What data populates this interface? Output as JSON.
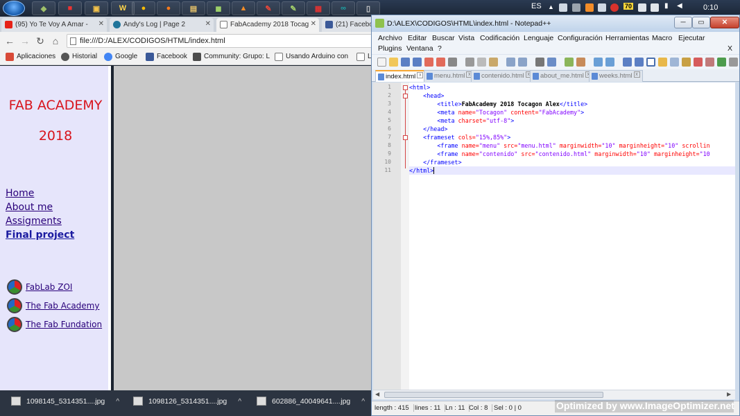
{
  "taskbar": {
    "apps": [
      "",
      "",
      "",
      "",
      "",
      "",
      "",
      "",
      "",
      "",
      "",
      "",
      "",
      ""
    ],
    "language": "ES",
    "badge": "70",
    "clock": "0:10"
  },
  "browser": {
    "tabs": [
      {
        "label": "(95) Yo Te Voy A Amar -",
        "color": "#e62117"
      },
      {
        "label": "Andy's Log | Page 2",
        "color": "#21759b"
      },
      {
        "label": "FabAcademy 2018 Tocag",
        "color": "#777777"
      },
      {
        "label": "(21) Facebo",
        "color": "#3b5998"
      }
    ],
    "url": "file:///D:/ALEX/CODIGOS/HTML/index.html",
    "bookmarks": [
      {
        "label": "Aplicaciones",
        "color": "#d84a38"
      },
      {
        "label": "Historial",
        "color": "#555555"
      },
      {
        "label": "Google",
        "color": "#4285f4"
      },
      {
        "label": "Facebook",
        "color": "#3b5998"
      },
      {
        "label": "Community: Grupo: L",
        "color": "#4c4c4c"
      },
      {
        "label": "Usando Arduino con",
        "color": "#777777"
      },
      {
        "label": "L",
        "color": "#777777"
      }
    ]
  },
  "page": {
    "title_line1": "FAB ACADEMY",
    "title_line2": "2018",
    "menu": [
      "Home",
      "About me",
      "Assigments",
      "Final project"
    ],
    "fab_links": [
      "FabLab ZOI",
      "The Fab Academy",
      "The Fab Fundation"
    ]
  },
  "downloads": [
    "1098145_5314351....jpg",
    "1098126_5314351....jpg",
    "602886_40049641....jpg"
  ],
  "notepad": {
    "title": "D:\\ALEX\\CODIGOS\\HTML\\index.html - Notepad++",
    "menu_row1": [
      "Archivo",
      "Editar",
      "Buscar",
      "Vista",
      "Codificación",
      "Lenguaje",
      "Configuración",
      "Herramientas",
      "Macro",
      "Ejecutar"
    ],
    "menu_row2": [
      "Plugins",
      "Ventana",
      "?"
    ],
    "close_x": "X",
    "tabs": [
      "index.html",
      "menu.html",
      "contenido.html",
      "about_me.html",
      "weeks.html"
    ],
    "line_numbers": [
      "1",
      "2",
      "3",
      "4",
      "5",
      "6",
      "7",
      "8",
      "9",
      "10",
      "11"
    ],
    "code": {
      "l1": "<html>",
      "l2": "<head>",
      "l3_open": "<title>",
      "l3_text": "FabAcademy 2018 Tocagon Alex",
      "l3_close": "</title>",
      "l4_tag": "<meta ",
      "l4_a1": "name=",
      "l4_v1": "\"Tocagon\"",
      "l4_a2": " content=",
      "l4_v2": "\"FabAcademy\"",
      "l4_end": ">",
      "l5_tag": "<meta ",
      "l5_a1": "charset=",
      "l5_v1": "\"utf-8\"",
      "l5_end": ">",
      "l6": "</head>",
      "l7_tag": "<frameset ",
      "l7_a1": "cols=",
      "l7_v1": "\"15%,85%\"",
      "l7_end": ">",
      "l8_tag": "<frame ",
      "l8_a1": "name=",
      "l8_v1": "\"menu\"",
      "l8_a2": " src=",
      "l8_v2": "\"menu.html\"",
      "l8_a3": " marginwidth=",
      "l8_v3": "\"10\"",
      "l8_a4": " marginheight=",
      "l8_v4": "\"10\"",
      "l8_a5": " scrollin",
      "l9_tag": "<frame ",
      "l9_a1": "name=",
      "l9_v1": "\"contenido\"",
      "l9_a2": " src=",
      "l9_v2": "\"contenido.html\"",
      "l9_a3": " marginwidth=",
      "l9_v3": "\"10\"",
      "l9_a4": " marginheight=",
      "l9_v4": "\"10",
      "l10": "</frameset>",
      "l11": "</html>"
    },
    "status": [
      "length : 415",
      "lines : 11",
      "Ln : 11",
      "Col : 8",
      "Sel : 0 | 0"
    ]
  },
  "watermark": "Optimized by www.ImageOptimizer.net"
}
